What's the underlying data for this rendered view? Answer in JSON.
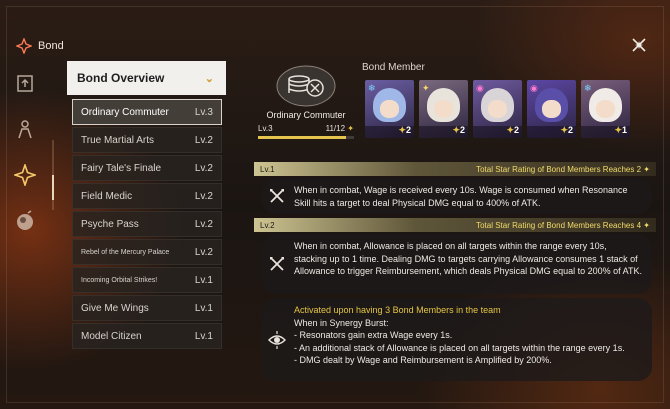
{
  "header": {
    "title": "Bond",
    "bond_icon": "bond-emblem-icon",
    "close_icon": "close-icon"
  },
  "nav": {
    "icons": [
      "upload-icon",
      "figure-icon",
      "bond-star-icon",
      "orb-icon"
    ],
    "active_index": 2
  },
  "overview": {
    "label": "Bond Overview",
    "chevron": "⌄"
  },
  "bonds": [
    {
      "name": "Ordinary Commuter",
      "level": "Lv.3",
      "selected": true
    },
    {
      "name": "True Martial Arts",
      "level": "Lv.2"
    },
    {
      "name": "Fairy Tale's Finale",
      "level": "Lv.2"
    },
    {
      "name": "Field Medic",
      "level": "Lv.2"
    },
    {
      "name": "Psyche Pass",
      "level": "Lv.2"
    },
    {
      "name": "Rebel of the Mercury Palace",
      "level": "Lv.2"
    },
    {
      "name": "Incoming Orbital Strikes!",
      "level": "Lv.1"
    },
    {
      "name": "Give Me Wings",
      "level": "Lv.1"
    },
    {
      "name": "Model Citizen",
      "level": "Lv.1"
    }
  ],
  "selected_bond": {
    "name": "Ordinary Commuter",
    "level": "Lv.3",
    "progress_text": "11/12",
    "progress_fraction": 0.9167
  },
  "members": {
    "title": "Bond Member",
    "list": [
      {
        "stars": "2",
        "element": "❄",
        "element_color": "#7fd3ff",
        "hair": "#9fb8e8",
        "bg": "#6b5fa3"
      },
      {
        "stars": "2",
        "element": "✦",
        "element_color": "#ffd86a",
        "hair": "#e8e4dc",
        "bg": "#7b6a7e"
      },
      {
        "stars": "2",
        "element": "◉",
        "element_color": "#ff7ad0",
        "hair": "#d9d4d8",
        "bg": "#6f5aa0"
      },
      {
        "stars": "2",
        "element": "◉",
        "element_color": "#ff7ad0",
        "hair": "#5a4fa8",
        "bg": "#5d47a6"
      },
      {
        "stars": "1",
        "element": "❄",
        "element_color": "#7fd3ff",
        "hair": "#f0ebe6",
        "bg": "#7a5f7c"
      }
    ]
  },
  "levels": [
    {
      "tag": "Lv.1",
      "condition": "Total Star Rating of Bond Members Reaches 2",
      "effect_icon": "crossed-swords-icon",
      "lines": [
        "When in combat, Wage is received every 10s. Wage is consumed when Resonance Skill hits a target to deal Physical DMG equal to 400% of ATK."
      ]
    },
    {
      "tag": "Lv.2",
      "condition": "Total Star Rating of Bond Members Reaches 4",
      "effect_icon": "crossed-swords-icon",
      "lines": [
        "When in combat, Allowance is placed on all targets within the range every 10s, stacking up to 1 time. Dealing DMG to targets carrying Allowance consumes 1 stack of Allowance to trigger Reimbursement, which deals Physical DMG equal to 200% of ATK."
      ]
    },
    {
      "effect_icon": "synergy-eye-icon",
      "highlight": "Activated upon having 3 Bond Members in the team",
      "lines": [
        "When in Synergy Burst:",
        "- Resonators gain extra Wage every 1s.",
        "- An additional stack of Allowance is placed on all targets within the range every 1s.",
        "- DMG dealt by Wage and Reimbursement is Amplified by 200%."
      ]
    }
  ]
}
